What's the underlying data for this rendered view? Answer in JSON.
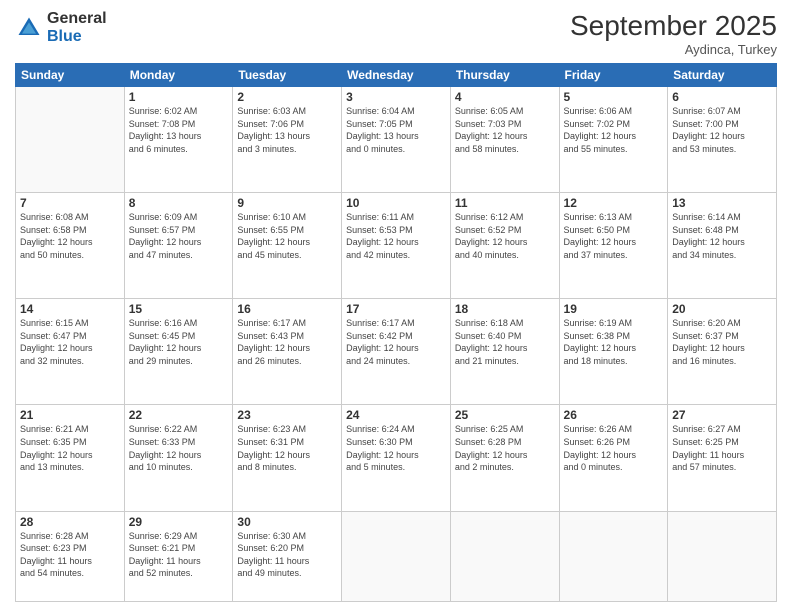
{
  "logo": {
    "general": "General",
    "blue": "Blue"
  },
  "title": {
    "month_year": "September 2025",
    "location": "Aydinca, Turkey"
  },
  "weekdays": [
    "Sunday",
    "Monday",
    "Tuesday",
    "Wednesday",
    "Thursday",
    "Friday",
    "Saturday"
  ],
  "weeks": [
    [
      {
        "day": "",
        "info": ""
      },
      {
        "day": "1",
        "info": "Sunrise: 6:02 AM\nSunset: 7:08 PM\nDaylight: 13 hours\nand 6 minutes."
      },
      {
        "day": "2",
        "info": "Sunrise: 6:03 AM\nSunset: 7:06 PM\nDaylight: 13 hours\nand 3 minutes."
      },
      {
        "day": "3",
        "info": "Sunrise: 6:04 AM\nSunset: 7:05 PM\nDaylight: 13 hours\nand 0 minutes."
      },
      {
        "day": "4",
        "info": "Sunrise: 6:05 AM\nSunset: 7:03 PM\nDaylight: 12 hours\nand 58 minutes."
      },
      {
        "day": "5",
        "info": "Sunrise: 6:06 AM\nSunset: 7:02 PM\nDaylight: 12 hours\nand 55 minutes."
      },
      {
        "day": "6",
        "info": "Sunrise: 6:07 AM\nSunset: 7:00 PM\nDaylight: 12 hours\nand 53 minutes."
      }
    ],
    [
      {
        "day": "7",
        "info": "Sunrise: 6:08 AM\nSunset: 6:58 PM\nDaylight: 12 hours\nand 50 minutes."
      },
      {
        "day": "8",
        "info": "Sunrise: 6:09 AM\nSunset: 6:57 PM\nDaylight: 12 hours\nand 47 minutes."
      },
      {
        "day": "9",
        "info": "Sunrise: 6:10 AM\nSunset: 6:55 PM\nDaylight: 12 hours\nand 45 minutes."
      },
      {
        "day": "10",
        "info": "Sunrise: 6:11 AM\nSunset: 6:53 PM\nDaylight: 12 hours\nand 42 minutes."
      },
      {
        "day": "11",
        "info": "Sunrise: 6:12 AM\nSunset: 6:52 PM\nDaylight: 12 hours\nand 40 minutes."
      },
      {
        "day": "12",
        "info": "Sunrise: 6:13 AM\nSunset: 6:50 PM\nDaylight: 12 hours\nand 37 minutes."
      },
      {
        "day": "13",
        "info": "Sunrise: 6:14 AM\nSunset: 6:48 PM\nDaylight: 12 hours\nand 34 minutes."
      }
    ],
    [
      {
        "day": "14",
        "info": "Sunrise: 6:15 AM\nSunset: 6:47 PM\nDaylight: 12 hours\nand 32 minutes."
      },
      {
        "day": "15",
        "info": "Sunrise: 6:16 AM\nSunset: 6:45 PM\nDaylight: 12 hours\nand 29 minutes."
      },
      {
        "day": "16",
        "info": "Sunrise: 6:17 AM\nSunset: 6:43 PM\nDaylight: 12 hours\nand 26 minutes."
      },
      {
        "day": "17",
        "info": "Sunrise: 6:17 AM\nSunset: 6:42 PM\nDaylight: 12 hours\nand 24 minutes."
      },
      {
        "day": "18",
        "info": "Sunrise: 6:18 AM\nSunset: 6:40 PM\nDaylight: 12 hours\nand 21 minutes."
      },
      {
        "day": "19",
        "info": "Sunrise: 6:19 AM\nSunset: 6:38 PM\nDaylight: 12 hours\nand 18 minutes."
      },
      {
        "day": "20",
        "info": "Sunrise: 6:20 AM\nSunset: 6:37 PM\nDaylight: 12 hours\nand 16 minutes."
      }
    ],
    [
      {
        "day": "21",
        "info": "Sunrise: 6:21 AM\nSunset: 6:35 PM\nDaylight: 12 hours\nand 13 minutes."
      },
      {
        "day": "22",
        "info": "Sunrise: 6:22 AM\nSunset: 6:33 PM\nDaylight: 12 hours\nand 10 minutes."
      },
      {
        "day": "23",
        "info": "Sunrise: 6:23 AM\nSunset: 6:31 PM\nDaylight: 12 hours\nand 8 minutes."
      },
      {
        "day": "24",
        "info": "Sunrise: 6:24 AM\nSunset: 6:30 PM\nDaylight: 12 hours\nand 5 minutes."
      },
      {
        "day": "25",
        "info": "Sunrise: 6:25 AM\nSunset: 6:28 PM\nDaylight: 12 hours\nand 2 minutes."
      },
      {
        "day": "26",
        "info": "Sunrise: 6:26 AM\nSunset: 6:26 PM\nDaylight: 12 hours\nand 0 minutes."
      },
      {
        "day": "27",
        "info": "Sunrise: 6:27 AM\nSunset: 6:25 PM\nDaylight: 11 hours\nand 57 minutes."
      }
    ],
    [
      {
        "day": "28",
        "info": "Sunrise: 6:28 AM\nSunset: 6:23 PM\nDaylight: 11 hours\nand 54 minutes."
      },
      {
        "day": "29",
        "info": "Sunrise: 6:29 AM\nSunset: 6:21 PM\nDaylight: 11 hours\nand 52 minutes."
      },
      {
        "day": "30",
        "info": "Sunrise: 6:30 AM\nSunset: 6:20 PM\nDaylight: 11 hours\nand 49 minutes."
      },
      {
        "day": "",
        "info": ""
      },
      {
        "day": "",
        "info": ""
      },
      {
        "day": "",
        "info": ""
      },
      {
        "day": "",
        "info": ""
      }
    ]
  ]
}
